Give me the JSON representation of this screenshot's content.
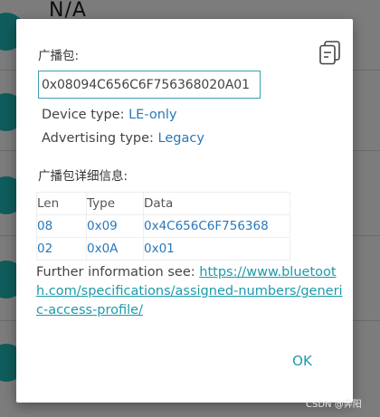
{
  "background": {
    "title": "N/A"
  },
  "dialog": {
    "raw_label": "广播包:",
    "raw_value": "0x08094C656C6F756368020A01",
    "device_type_label": "Device type: ",
    "device_type_value": "LE-only",
    "adv_type_label": "Advertising type: ",
    "adv_type_value": "Legacy",
    "detail_label": "广播包详细信息:",
    "table": {
      "headers": [
        "Len",
        "Type",
        "Data"
      ],
      "rows": [
        [
          "08",
          "0x09",
          "0x4C656C6F756368"
        ],
        [
          "02",
          "0x0A",
          "0x01"
        ]
      ]
    },
    "further_text": "Further information see: ",
    "further_link": "https://www.bluetooth.com/specifications/assigned-numbers/generic-access-profile/",
    "ok_label": "OK",
    "copy_icon": "copy-icon"
  },
  "watermark": "CSDN @奔阳",
  "colors": {
    "accent": "#1e9aa9",
    "value_blue": "#2a78b8",
    "avatar": "#0f5c5c"
  }
}
